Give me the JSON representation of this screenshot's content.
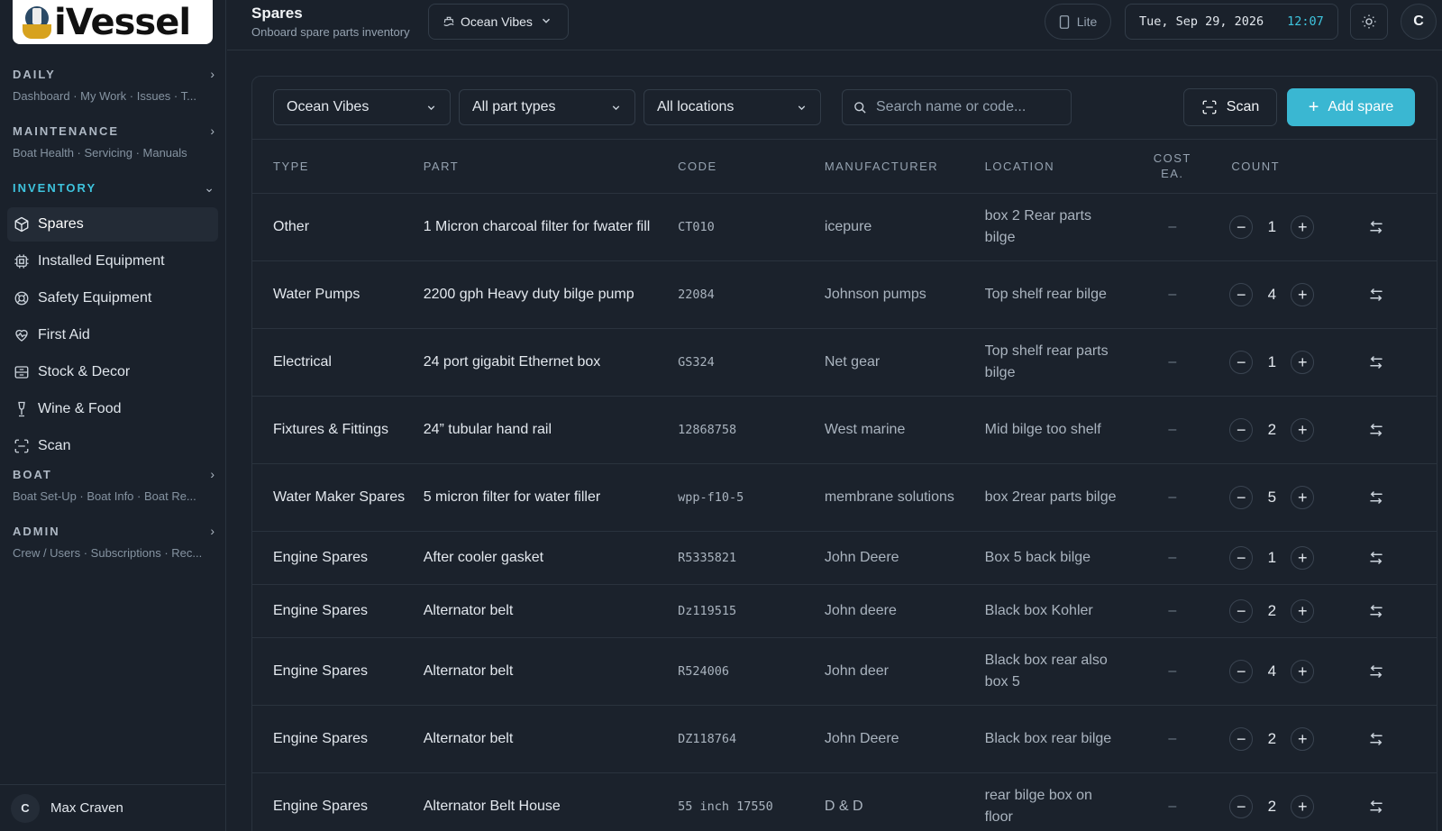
{
  "app": {
    "logo_text": "iVessel"
  },
  "sidebar": {
    "sections": [
      {
        "title": "DAILY",
        "subtitle": "Dashboard · My Work · Issues · T...",
        "expanded": false
      },
      {
        "title": "MAINTENANCE",
        "subtitle": "Boat Health · Servicing · Manuals",
        "expanded": false
      },
      {
        "title": "INVENTORY",
        "subtitle": "",
        "expanded": true
      },
      {
        "title": "BOAT",
        "subtitle": "Boat Set-Up · Boat Info · Boat Re...",
        "expanded": false
      },
      {
        "title": "ADMIN",
        "subtitle": "Crew / Users · Subscriptions · Rec...",
        "expanded": false
      }
    ],
    "items": [
      {
        "label": "Spares",
        "icon": "box-icon",
        "active": true
      },
      {
        "label": "Installed Equipment",
        "icon": "chip-icon",
        "active": false
      },
      {
        "label": "Safety Equipment",
        "icon": "lifebuoy-icon",
        "active": false
      },
      {
        "label": "First Aid",
        "icon": "heart-pulse-icon",
        "active": false
      },
      {
        "label": "Stock & Decor",
        "icon": "cabinet-icon",
        "active": false
      },
      {
        "label": "Wine & Food",
        "icon": "wine-glass-icon",
        "active": false
      },
      {
        "label": "Scan",
        "icon": "scan-icon",
        "active": false
      }
    ],
    "user": {
      "initial": "C",
      "name": "Max Craven"
    }
  },
  "header": {
    "title": "Spares",
    "subtitle": "Onboard spare parts inventory",
    "vessel": "Ocean Vibes",
    "mode": "Lite",
    "date": "Tue, Sep 29, 2026",
    "time": "12:07",
    "avatar_initial": "C"
  },
  "filters": {
    "vessel": "Ocean Vibes",
    "part_type": "All part types",
    "location": "All locations",
    "search_placeholder": "Search name or code...",
    "scan_label": "Scan",
    "add_label": "Add spare"
  },
  "table": {
    "headers": {
      "type": "TYPE",
      "part": "PART",
      "code": "CODE",
      "manufacturer": "MANUFACTURER",
      "location": "LOCATION",
      "cost_line1": "COST",
      "cost_line2": "EA.",
      "count": "COUNT"
    },
    "rows": [
      {
        "type": "Other",
        "part": "1 Micron charcoal filter for fwater fill",
        "code": "CT010",
        "manufacturer": "icepure",
        "location": "box 2 Rear parts bilge",
        "cost": "–",
        "count": "1"
      },
      {
        "type": "Water Pumps",
        "part": "2200 gph Heavy duty bilge pump",
        "code": "22084",
        "manufacturer": "Johnson pumps",
        "location": "Top shelf rear bilge",
        "cost": "–",
        "count": "4"
      },
      {
        "type": "Electrical",
        "part": "24 port gigabit Ethernet box",
        "code": "GS324",
        "manufacturer": "Net gear",
        "location": "Top shelf rear parts bilge",
        "cost": "–",
        "count": "1"
      },
      {
        "type": "Fixtures & Fittings",
        "part": "24” tubular hand rail",
        "code": "12868758",
        "manufacturer": "West marine",
        "location": "Mid bilge too shelf",
        "cost": "–",
        "count": "2"
      },
      {
        "type": "Water Maker Spares",
        "part": "5 micron filter for water filler",
        "code": "wpp-f10-5",
        "manufacturer": "membrane solutions",
        "location": "box 2rear parts bilge",
        "cost": "–",
        "count": "5"
      },
      {
        "type": "Engine Spares",
        "part": "After cooler gasket",
        "code": "R5335821",
        "manufacturer": "John Deere",
        "location": "Box 5 back bilge",
        "cost": "–",
        "count": "1"
      },
      {
        "type": "Engine Spares",
        "part": "Alternator belt",
        "code": "Dz119515",
        "manufacturer": "John deere",
        "location": "Black box Kohler",
        "cost": "–",
        "count": "2"
      },
      {
        "type": "Engine Spares",
        "part": "Alternator belt",
        "code": "R524006",
        "manufacturer": "John deer",
        "location": "Black box rear also box 5",
        "cost": "–",
        "count": "4"
      },
      {
        "type": "Engine Spares",
        "part": "Alternator belt",
        "code": "DZ118764",
        "manufacturer": "John Deere",
        "location": "Black box rear bilge",
        "cost": "–",
        "count": "2"
      },
      {
        "type": "Engine Spares",
        "part": "Alternator Belt House",
        "code": "55 inch 17550",
        "manufacturer": "D & D",
        "location": "rear bilge box on floor",
        "cost": "–",
        "count": "2"
      }
    ]
  },
  "colors": {
    "accent": "#3ec4de",
    "add_button": "#3ab7d2",
    "background": "#1a212b"
  }
}
